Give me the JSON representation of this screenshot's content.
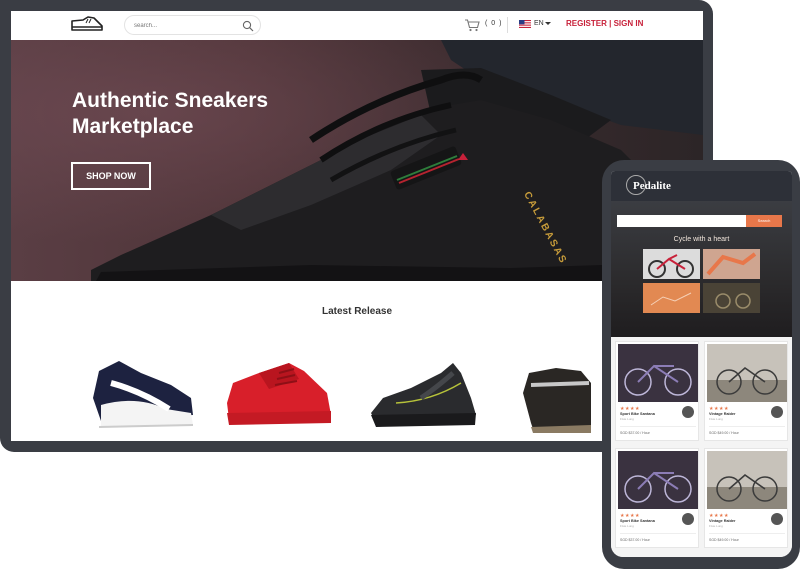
{
  "desktop": {
    "header": {
      "search_placeholder": "search...",
      "cart_count": "( 0 )",
      "language": "EN",
      "auth": {
        "register": "REGISTER",
        "separator": " | ",
        "signin": "SIGN IN"
      }
    },
    "hero": {
      "title_line1": "Authentic Sneakers",
      "title_line2": "Marketplace",
      "cta": "SHOP NOW",
      "shoe_text": "CALABASAS"
    },
    "latest": {
      "title": "Latest Release"
    },
    "colors": {
      "accent": "#c8213a",
      "frame": "#3a3d44"
    }
  },
  "mobile": {
    "brand": "Pedalite",
    "search_button": "Search",
    "tagline": "Cycle with a heart",
    "cards": [
      {
        "name": "Sport Bike Santana",
        "sub": "Fixie Lung",
        "stars": "★★★★",
        "price": "SGD $37.00 / Hour"
      },
      {
        "name": "Vintage Raider",
        "sub": "Fixie Lung",
        "stars": "★★★★",
        "price": "SGD $49.00 / Hour"
      },
      {
        "name": "Sport Bike Santana",
        "sub": "Fixie Lung",
        "stars": "★★★★",
        "price": "SGD $37.00 / Hour"
      },
      {
        "name": "Vintage Raider",
        "sub": "Fixie Lung",
        "stars": "★★★★",
        "price": "SGD $49.00 / Hour"
      }
    ],
    "colors": {
      "accent": "#e8774a"
    }
  }
}
